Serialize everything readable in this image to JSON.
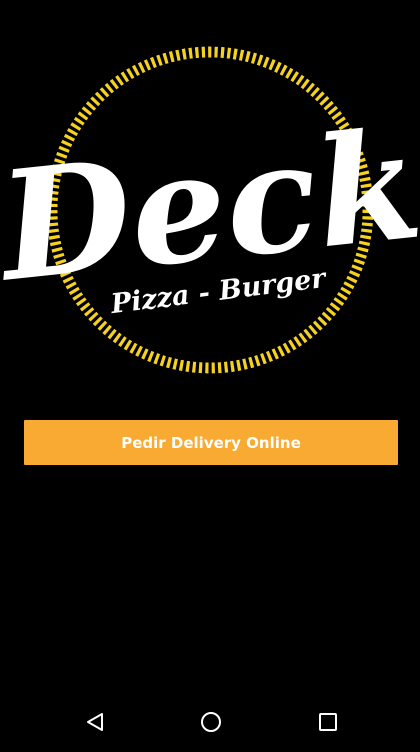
{
  "logo": {
    "brand": "Deck",
    "tagline": "Pizza - Burger",
    "ring_icon": "dashed-ring-icon",
    "colors": {
      "ring_stripe": "#F6D21E",
      "text": "#FFFFFF"
    }
  },
  "cta": {
    "label": "Pedir Delivery Online",
    "color": "#F9AA33"
  },
  "navbar": {
    "back_icon": "back-triangle-icon",
    "home_icon": "home-circle-icon",
    "recents_icon": "recents-square-icon"
  }
}
